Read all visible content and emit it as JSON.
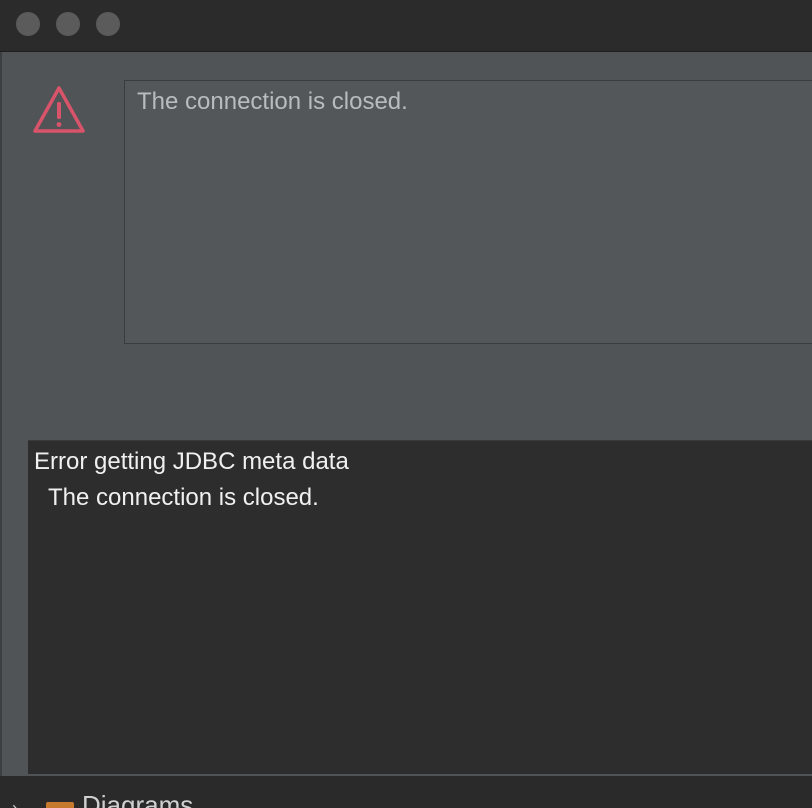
{
  "dialog": {
    "message": "The connection is closed.",
    "details": {
      "line1": "Error getting JDBC meta data",
      "line2": "The connection is closed."
    },
    "icon": "warning-triangle-icon",
    "accent_color": "#d9536a"
  },
  "background_tree": {
    "item_label": "Diagrams",
    "icon": "folder-icon"
  }
}
